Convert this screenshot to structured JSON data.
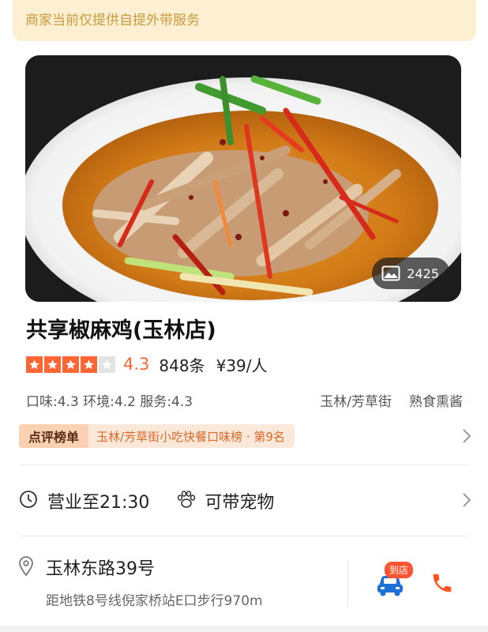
{
  "notice": "商家当前仅提供自提外带服务",
  "hero": {
    "photo_count": "2425"
  },
  "shop": {
    "name": "共享椒麻鸡(玉林店)",
    "stars": 4,
    "score": "4.3",
    "reviews": "848条",
    "price": "¥39/人",
    "subscores": "口味:4.3 环境:4.2 服务:4.3",
    "area": "玉林/芳草街",
    "category": "熟食熏酱"
  },
  "ranking": {
    "badge": "点评榜单",
    "text": "玉林/芳草街小吃快餐口味榜 · 第9名"
  },
  "info": {
    "hours": "营业至21:30",
    "pets": "可带宠物",
    "address": "玉林东路39号",
    "subway": "距地铁8号线倪家桥站E口步行970m",
    "drive_badge": "到店"
  },
  "colors": {
    "accent": "#ff6633",
    "notice_bg": "#fdf0d2",
    "notice_text": "#c99a3c",
    "rank_text": "#d96a2a"
  },
  "icons": [
    "image-icon",
    "star-icon",
    "clock-icon",
    "paw-icon",
    "chevron-right-icon",
    "location-pin-icon",
    "car-icon",
    "phone-icon"
  ]
}
